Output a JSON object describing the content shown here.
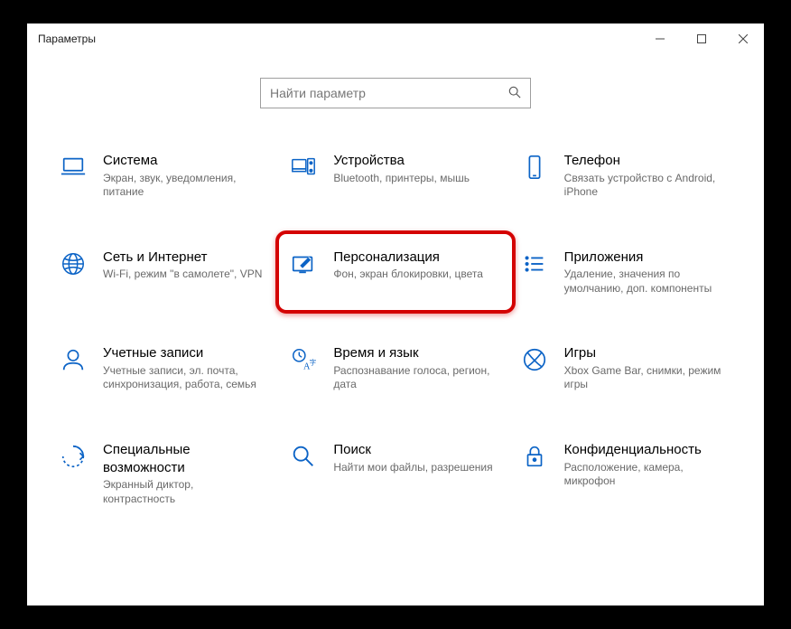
{
  "window": {
    "title": "Параметры"
  },
  "search": {
    "placeholder": "Найти параметр"
  },
  "tiles": [
    {
      "title": "Система",
      "desc": "Экран, звук, уведомления, питание"
    },
    {
      "title": "Устройства",
      "desc": "Bluetooth, принтеры, мышь"
    },
    {
      "title": "Телефон",
      "desc": "Связать устройство с Android, iPhone"
    },
    {
      "title": "Сеть и Интернет",
      "desc": "Wi-Fi, режим \"в самолете\", VPN"
    },
    {
      "title": "Персонализация",
      "desc": "Фон, экран блокировки, цвета"
    },
    {
      "title": "Приложения",
      "desc": "Удаление, значения по умолчанию, доп. компоненты"
    },
    {
      "title": "Учетные записи",
      "desc": "Учетные записи, эл. почта, синхронизация, работа, семья"
    },
    {
      "title": "Время и язык",
      "desc": "Распознавание голоса, регион, дата"
    },
    {
      "title": "Игры",
      "desc": "Xbox Game Bar, снимки, режим игры"
    },
    {
      "title": "Специальные возможности",
      "desc": "Экранный диктор, контрастность"
    },
    {
      "title": "Поиск",
      "desc": "Найти мои файлы, разрешения"
    },
    {
      "title": "Конфиденциальность",
      "desc": "Расположение, камера, микрофон"
    }
  ],
  "highlighted_index": 4
}
